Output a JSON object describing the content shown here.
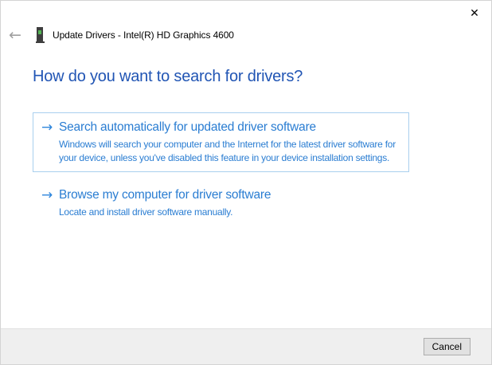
{
  "window": {
    "title": "Update Drivers - Intel(R) HD Graphics 4600"
  },
  "icons": {
    "close": "✕",
    "back": "←",
    "option_arrow": "→",
    "device": "display-adapter-icon"
  },
  "heading": "How do you want to search for drivers?",
  "options": [
    {
      "title": "Search automatically for updated driver software",
      "description": "Windows will search your computer and the Internet for the latest driver software for your device, unless you've disabled this feature in your device installation settings.",
      "focused": true
    },
    {
      "title": "Browse my computer for driver software",
      "description": "Locate and install driver software manually.",
      "focused": false
    }
  ],
  "footer": {
    "cancel_label": "Cancel"
  },
  "colors": {
    "heading_text": "#2155b4",
    "link_text": "#2a7dd2",
    "arrow": "#2e86dc",
    "focused_option_border": "#a9cfee",
    "footer_bg": "#efefef",
    "footer_divider": "#e0e0e0",
    "button_bg": "#e1e1e1",
    "button_border": "#adadad",
    "dialog_border": "#d4d4d4",
    "device_icon_body": "#3e3e3e",
    "device_icon_screen": "#54b554",
    "back_arrow": "#9f9f9f"
  }
}
